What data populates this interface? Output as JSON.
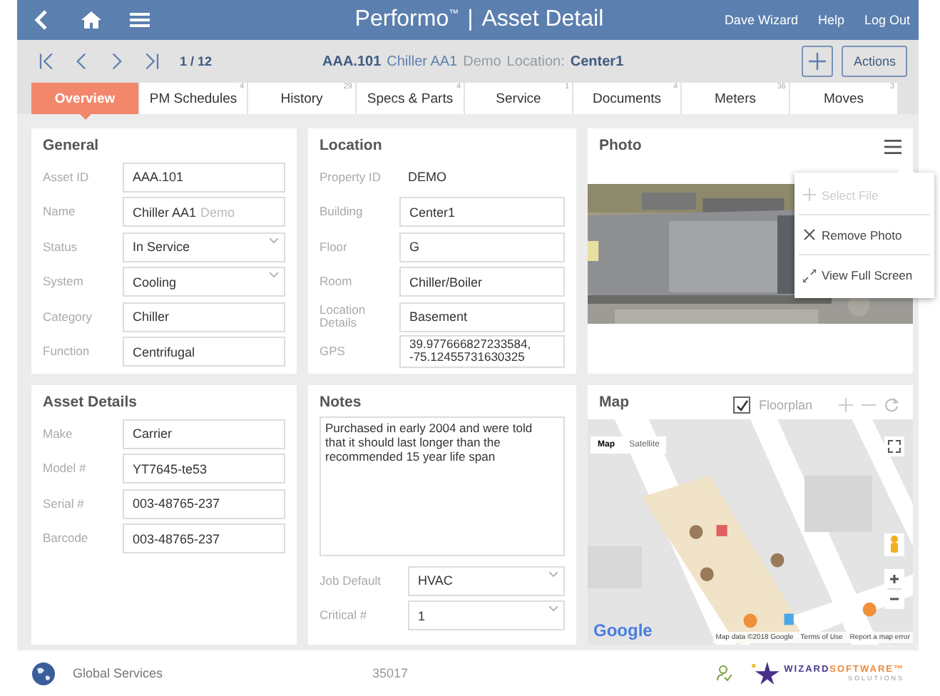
{
  "header": {
    "brand": "Performo$^{™}$",
    "separator": "|",
    "title": "Asset Detail",
    "links": [
      "Dave Wizard",
      "Help",
      "Log Out"
    ]
  },
  "record_nav": {
    "position": "1 / 12",
    "asset_id": "AAA.101",
    "asset_name": "Chiller AA1",
    "asset_tag": "Demo",
    "location_label": "Location:",
    "location": "Center1",
    "actions_button": "Actions"
  },
  "tabs": [
    {
      "label": "Overview",
      "selected": true
    },
    {
      "label": "PM Schedules",
      "count": "4",
      "selected": false
    },
    {
      "label": "History",
      "count": "29",
      "selected": false
    },
    {
      "label": "Specs & Parts",
      "count": "4",
      "selected": false
    },
    {
      "label": "Service",
      "count": "1",
      "selected": false
    },
    {
      "label": "Documents",
      "count": "4",
      "selected": false
    },
    {
      "label": "Meters",
      "count": "36",
      "selected": false
    },
    {
      "label": "Moves",
      "count": "3",
      "selected": false
    }
  ],
  "general": {
    "title": "General",
    "fields": [
      {
        "label": "Asset ID",
        "value": "AAA.101",
        "kind": "text"
      },
      {
        "label": "Name",
        "value": "Chiller AA1",
        "suffix": "Demo",
        "kind": "text"
      },
      {
        "label": "Status",
        "value": "In Service",
        "kind": "select"
      },
      {
        "label": "System",
        "value": "Cooling",
        "kind": "select"
      },
      {
        "label": "Category",
        "value": "Chiller",
        "kind": "text"
      },
      {
        "label": "Function",
        "value": "Centrifugal",
        "kind": "text"
      }
    ]
  },
  "location": {
    "title": "Location",
    "fields": [
      {
        "label": "Property ID",
        "value": "DEMO",
        "kind": "static"
      },
      {
        "label": "Building",
        "value": "Center1",
        "kind": "text"
      },
      {
        "label": "Floor",
        "value": "G",
        "kind": "text"
      },
      {
        "label": "Room",
        "value": "Chiller/Boiler",
        "kind": "text"
      },
      {
        "label": "Location Details",
        "value": "Basement",
        "kind": "text"
      },
      {
        "label": "GPS",
        "value": "39.977666827233584, -75.12455731630325",
        "kind": "multiline"
      }
    ]
  },
  "photo": {
    "title": "Photo",
    "menu": [
      {
        "label": "Select File",
        "kind": "add",
        "disabled": true
      },
      {
        "label": "Remove Photo",
        "kind": "remove",
        "disabled": false
      },
      {
        "label": "View Full Screen",
        "kind": "fullscreen",
        "disabled": false
      }
    ]
  },
  "asset_details": {
    "title": "Asset Details",
    "fields": [
      {
        "label": "Make",
        "value": "Carrier",
        "kind": "text"
      },
      {
        "label": "Model #",
        "value": "YT7645-te53",
        "kind": "text"
      },
      {
        "label": "Serial #",
        "value": "003-48765-237",
        "kind": "text"
      },
      {
        "label": "Barcode",
        "value": "003-48765-237",
        "kind": "text"
      }
    ]
  },
  "notes": {
    "title": "Notes",
    "text": "Purchased in early 2004 and were told that it should last longer than the recommended 15 year life span",
    "fields": [
      {
        "label": "Job Default",
        "value": "HVAC",
        "kind": "select"
      },
      {
        "label": "Critical #",
        "value": "1",
        "kind": "select"
      }
    ]
  },
  "map": {
    "title": "Map",
    "floorplan": {
      "label": "Floorplan",
      "checked": true
    },
    "map_types": [
      {
        "label": "Map",
        "selected": true
      },
      {
        "label": "Satellite",
        "selected": false
      }
    ],
    "logo": "Google",
    "attribution": [
      "Map data ©2018 Google",
      "Terms of Use",
      "Report a map error"
    ]
  },
  "footer": {
    "company": "Global Services",
    "code": "35017",
    "logo_name": "WIZARD",
    "logo_accent": "SOFTWARE™",
    "logo_sub": "SOLUTIONS"
  }
}
